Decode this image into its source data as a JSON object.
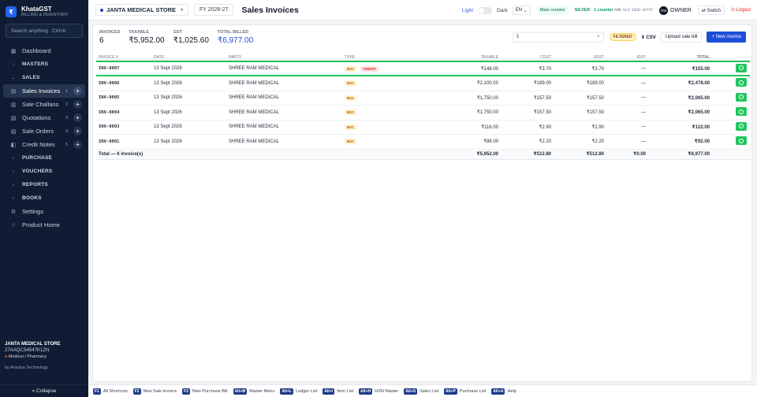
{
  "brand": {
    "logo_glyph": "₹",
    "name": "KhataGST",
    "subtitle": "BILLING & INVENTORY"
  },
  "sidebar": {
    "search_placeholder": "Search anything",
    "search_shortcut": "Ctrl+K",
    "items": [
      {
        "label": "Dashboard",
        "icon": "grid-icon",
        "glyph": "▦"
      },
      {
        "label": "MASTERS",
        "group": true,
        "glyph": "›"
      },
      {
        "label": "SALES",
        "group": true,
        "glyph": "⌄"
      },
      {
        "label": "Sales Invoices",
        "icon": "invoice-icon",
        "glyph": "▤",
        "count": "1",
        "active": true
      },
      {
        "label": "Sale Challans",
        "icon": "challan-icon",
        "glyph": "▥",
        "count": "2"
      },
      {
        "label": "Quotations",
        "icon": "quote-icon",
        "glyph": "▧",
        "count": "3"
      },
      {
        "label": "Sale Orders",
        "icon": "order-icon",
        "glyph": "▨",
        "count": "4"
      },
      {
        "label": "Credit Notes",
        "icon": "credit-note-icon",
        "glyph": "◧",
        "count": "5"
      },
      {
        "label": "PURCHASE",
        "group": true,
        "glyph": "›"
      },
      {
        "label": "VOUCHERS",
        "group": true,
        "glyph": "›"
      },
      {
        "label": "REPORTS",
        "group": true,
        "glyph": "›"
      },
      {
        "label": "BOOKS",
        "group": true,
        "glyph": "›"
      },
      {
        "label": "Settings",
        "icon": "gear-icon",
        "glyph": "⚙"
      },
      {
        "label": "Product Home",
        "icon": "home-icon",
        "glyph": "⌂"
      }
    ],
    "footer": {
      "store": "JANTA MEDICAL STORE",
      "gstin": "27AAQCS4547K1ZN",
      "category": "Medical / Pharmacy",
      "by": "by Anedya Technology",
      "collapse": "« Collapse"
    }
  },
  "topbar": {
    "store": "JANTA MEDICAL STORE",
    "fy": "FY 2026-27",
    "title": "Sales Invoices",
    "theme_light": "Light",
    "theme_dark": "Dark",
    "lang": "EN",
    "counter": "Main counter",
    "plan": "SILVER · 1 counter",
    "license": "ANR-SLV-2026-4CF97",
    "user_initials": "OW",
    "user_role": "OWNER",
    "switch": "⇄ Switch",
    "logout": "⏻ Logout"
  },
  "stats": [
    {
      "label": "INVOICES",
      "value": "6"
    },
    {
      "label": "TAXABLE",
      "value": "₹5,952.00"
    },
    {
      "label": "GST",
      "value": "₹1,025.60"
    },
    {
      "label": "TOTAL BILLED",
      "value": "₹6,977.00",
      "highlight": true
    }
  ],
  "actions": {
    "search_value": "$",
    "clear": "×",
    "filtered": "FILTERED",
    "csv": "⬇ CSV",
    "upload": "Upload sale bill",
    "new_invoice": "+ New invoice"
  },
  "table": {
    "headers": [
      "INVOICE #",
      "DATE",
      "PARTY",
      "TYPE",
      "TAXABLE",
      "CGST",
      "SGST",
      "IGST",
      "TOTAL"
    ],
    "rows": [
      {
        "inv": "INV-0007",
        "date": "13 Sept 2026",
        "party": "SHREE RAM MEDICAL",
        "type": "B2C",
        "credit": "CREDIT",
        "taxable": "₹148.00",
        "cgst": "₹3.70",
        "sgst": "₹3.70",
        "igst": "—",
        "total": "₹155.00"
      },
      {
        "inv": "INV-0006",
        "date": "13 Sept 2026",
        "party": "SHREE RAM MEDICAL",
        "type": "B2C",
        "credit": "",
        "taxable": "₹2,100.00",
        "cgst": "₹189.00",
        "sgst": "₹189.00",
        "igst": "—",
        "total": "₹2,478.00"
      },
      {
        "inv": "INV-0005",
        "date": "13 Sept 2026",
        "party": "SHREE RAM MEDICAL",
        "type": "B2C",
        "credit": "",
        "taxable": "₹1,750.00",
        "cgst": "₹157.50",
        "sgst": "₹157.50",
        "igst": "—",
        "total": "₹2,065.00"
      },
      {
        "inv": "INV-0004",
        "date": "13 Sept 2026",
        "party": "SHREE RAM MEDICAL",
        "type": "B2C",
        "credit": "",
        "taxable": "₹1,750.00",
        "cgst": "₹157.50",
        "sgst": "₹157.50",
        "igst": "—",
        "total": "₹2,065.00"
      },
      {
        "inv": "INV-0003",
        "date": "13 Sept 2026",
        "party": "SHREE RAM MEDICAL",
        "type": "B2C",
        "credit": "",
        "taxable": "₹116.00",
        "cgst": "₹2.90",
        "sgst": "₹2.90",
        "igst": "—",
        "total": "₹122.00"
      },
      {
        "inv": "INV-0001",
        "date": "13 Sept 2026",
        "party": "SHREE RAM MEDICAL",
        "type": "B2C",
        "credit": "",
        "taxable": "₹88.00",
        "cgst": "₹2.20",
        "sgst": "₹2.20",
        "igst": "—",
        "total": "₹92.00"
      }
    ],
    "totals": {
      "label": "Total — 6 invoice(s)",
      "taxable": "₹5,952.00",
      "cgst": "₹512.80",
      "sgst": "₹512.80",
      "igst": "₹0.00",
      "total": "₹6,977.00"
    }
  },
  "shortcuts": [
    {
      "key": "F1",
      "label": "All Shortcuts"
    },
    {
      "key": "F2",
      "label": "New Sale Invoice"
    },
    {
      "key": "F3",
      "label": "New Purchase Bill"
    },
    {
      "key": "Alt+M",
      "label": "Master Menu"
    },
    {
      "key": "Alt+L",
      "label": "Ledger List"
    },
    {
      "key": "Alt+I",
      "label": "Item List"
    },
    {
      "key": "Alt+H",
      "label": "HSN Master"
    },
    {
      "key": "Alt+S",
      "label": "Sales List"
    },
    {
      "key": "Alt+P",
      "label": "Purchase List"
    },
    {
      "key": "Alt+A",
      "label": "Help"
    }
  ],
  "colors": {
    "sidebar_bg": "#0f1c33",
    "accent": "#1d4ed8",
    "success": "#22c55e",
    "b2c_badge": "#fef3c7",
    "credit_badge": "#fee2e2"
  }
}
